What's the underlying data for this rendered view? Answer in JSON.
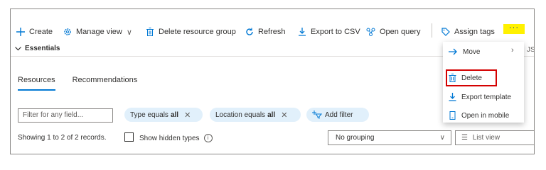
{
  "toolbar": {
    "create": "Create",
    "manage_view": "Manage view",
    "delete_group": "Delete resource group",
    "refresh": "Refresh",
    "export_csv": "Export to CSV",
    "open_query": "Open query",
    "assign_tags": "Assign tags",
    "more": "···"
  },
  "essentials": {
    "label": "Essentials",
    "json_view_clipped": "JSO"
  },
  "tabs": [
    {
      "label": "Resources"
    },
    {
      "label": "Recommendations"
    }
  ],
  "filters": {
    "search_placeholder": "Filter for any field...",
    "type_prefix": "Type equals",
    "type_value": "all",
    "location_prefix": "Location equals",
    "location_value": "all",
    "add_filter": "Add filter"
  },
  "records": {
    "summary": "Showing 1 to 2 of 2 records.",
    "show_hidden": "Show hidden types"
  },
  "grouping": {
    "value": "No grouping"
  },
  "list_view": {
    "label": "List view"
  },
  "context_menu": {
    "items": [
      {
        "label": "Move",
        "icon": "arrow-right-icon"
      },
      {
        "label": "Delete",
        "icon": "trash-icon"
      },
      {
        "label": "Export template",
        "icon": "download-icon"
      },
      {
        "label": "Open in mobile",
        "icon": "mobile-icon"
      }
    ]
  },
  "colors": {
    "accent": "#0078d4",
    "highlight_border": "#d40000",
    "more_bg": "#fff100",
    "pill_bg": "#e1f0fb"
  }
}
